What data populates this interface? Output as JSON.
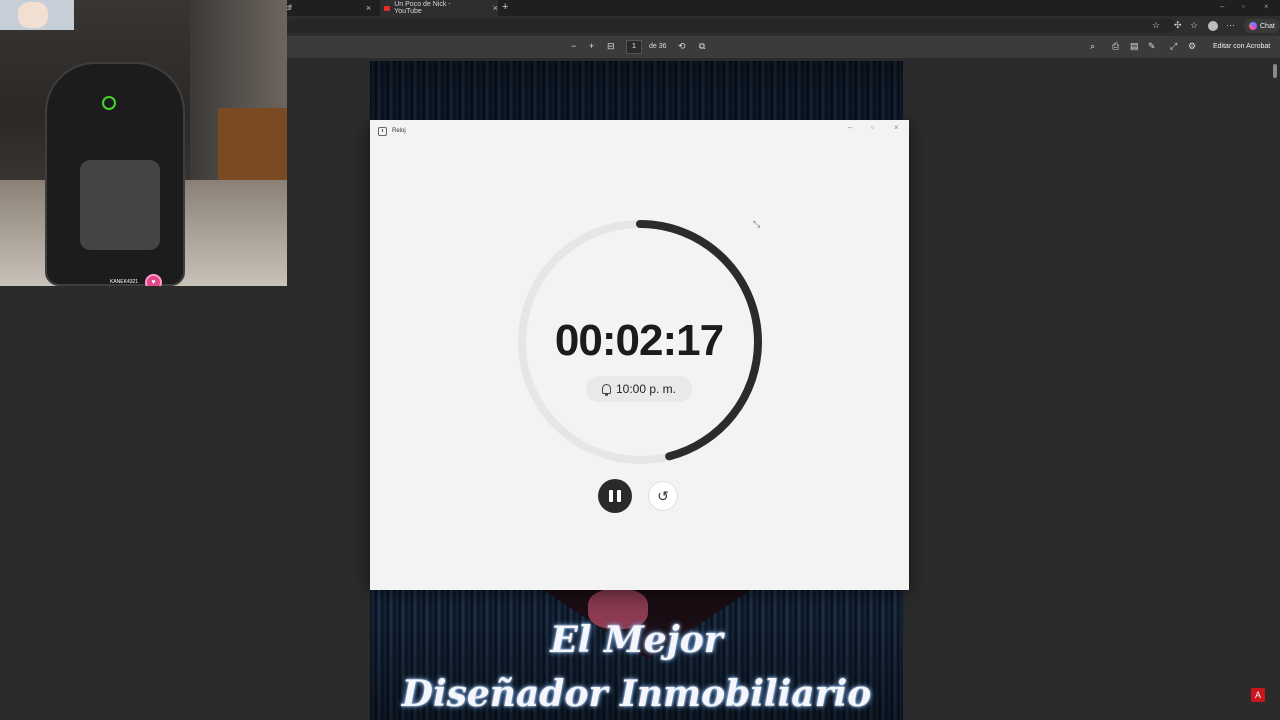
{
  "browser": {
    "tabs": [
      {
        "label": "df",
        "close": "×"
      },
      {
        "label": "Un Poco de Nick - YouTube",
        "close": "×"
      }
    ],
    "new_tab": "+",
    "chat_label": "Chat",
    "window_controls": [
      "–",
      "▫",
      "×"
    ]
  },
  "pdf_toolbar": {
    "zoom_out": "−",
    "zoom_in": "+",
    "current_page": "1",
    "page_of": "de 36",
    "edit_label": "Editar con Acrobat"
  },
  "pdf_page": {
    "line1": "El Mejor",
    "line2": "Diseñador Inmobiliario"
  },
  "webcam": {
    "streamer_name": "KANEK4321"
  },
  "clock_app": {
    "title": "Reloj",
    "time": "00:02:17",
    "alarm": "10:00 p. m.",
    "progress_fraction": 0.46,
    "colors": {
      "ring_track": "#e6e6e6",
      "ring_fill": "#2b2b2b",
      "pause_bg": "#2a2a2a"
    }
  }
}
